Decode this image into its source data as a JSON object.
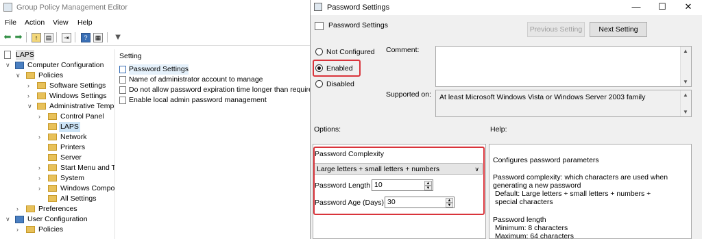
{
  "editor": {
    "title": "Group Policy Management Editor",
    "menu": [
      "File",
      "Action",
      "View",
      "Help"
    ],
    "toolbar_icons": [
      "back-icon",
      "forward-icon",
      "folder-up-icon",
      "show-hide-tree-icon",
      "export-icon",
      "help-icon",
      "properties-icon",
      "filter-icon"
    ],
    "tree": [
      {
        "label": "LAPS",
        "depth": 0,
        "icon": "doc"
      },
      {
        "label": "Computer Configuration",
        "depth": 0,
        "icon": "computer",
        "expanded": true
      },
      {
        "label": "Policies",
        "depth": 1,
        "icon": "folder",
        "expanded": true
      },
      {
        "label": "Software Settings",
        "depth": 2,
        "icon": "folder",
        "collapsed": true
      },
      {
        "label": "Windows Settings",
        "depth": 2,
        "icon": "folder",
        "collapsed": true
      },
      {
        "label": "Administrative Temp",
        "depth": 2,
        "icon": "folder",
        "expanded": true
      },
      {
        "label": "Control Panel",
        "depth": 3,
        "icon": "folder",
        "collapsed": true
      },
      {
        "label": "LAPS",
        "depth": 3,
        "icon": "folder",
        "selected": true
      },
      {
        "label": "Network",
        "depth": 3,
        "icon": "folder",
        "collapsed": true
      },
      {
        "label": "Printers",
        "depth": 3,
        "icon": "folder"
      },
      {
        "label": "Server",
        "depth": 3,
        "icon": "folder"
      },
      {
        "label": "Start Menu and T",
        "depth": 3,
        "icon": "folder",
        "collapsed": true
      },
      {
        "label": "System",
        "depth": 3,
        "icon": "folder",
        "collapsed": true
      },
      {
        "label": "Windows Compo",
        "depth": 3,
        "icon": "folder",
        "collapsed": true
      },
      {
        "label": "All Settings",
        "depth": 3,
        "icon": "folder"
      },
      {
        "label": "Preferences",
        "depth": 1,
        "icon": "folder",
        "collapsed": true
      },
      {
        "label": "User Configuration",
        "depth": 0,
        "icon": "computer",
        "expanded": true
      },
      {
        "label": "Policies",
        "depth": 1,
        "icon": "folder",
        "collapsed": true
      }
    ],
    "settings_header": "Setting",
    "settings": [
      {
        "label": "Password Settings",
        "selected": true
      },
      {
        "label": "Name of administrator account to manage"
      },
      {
        "label": "Do not allow password expiration time longer than required"
      },
      {
        "label": "Enable local admin password management"
      }
    ]
  },
  "dialog": {
    "title": "Password Settings",
    "heading": "Password Settings",
    "prev_button": "Previous Setting",
    "next_button": "Next Setting",
    "state_options": [
      "Not Configured",
      "Enabled",
      "Disabled"
    ],
    "selected_state": "Enabled",
    "comment_label": "Comment:",
    "comment_value": "",
    "supported_label": "Supported on:",
    "supported_value": "At least Microsoft Windows Vista or Windows Server 2003 family",
    "options_label": "Options:",
    "help_label": "Help:",
    "options": {
      "complexity_label": "Password Complexity",
      "complexity_value": "Large letters + small letters + numbers",
      "length_label": "Password Length",
      "length_value": "10",
      "age_label": "Password Age (Days)",
      "age_value": "30"
    },
    "help_text": [
      "Configures password parameters",
      "Password complexity: which characters are used when generating a new password",
      "Default: Large letters + small letters + numbers + special characters",
      "Password length",
      "Minimum: 8 characters",
      "Maximum: 64 characters"
    ],
    "highlight_color": "#d9343b"
  }
}
